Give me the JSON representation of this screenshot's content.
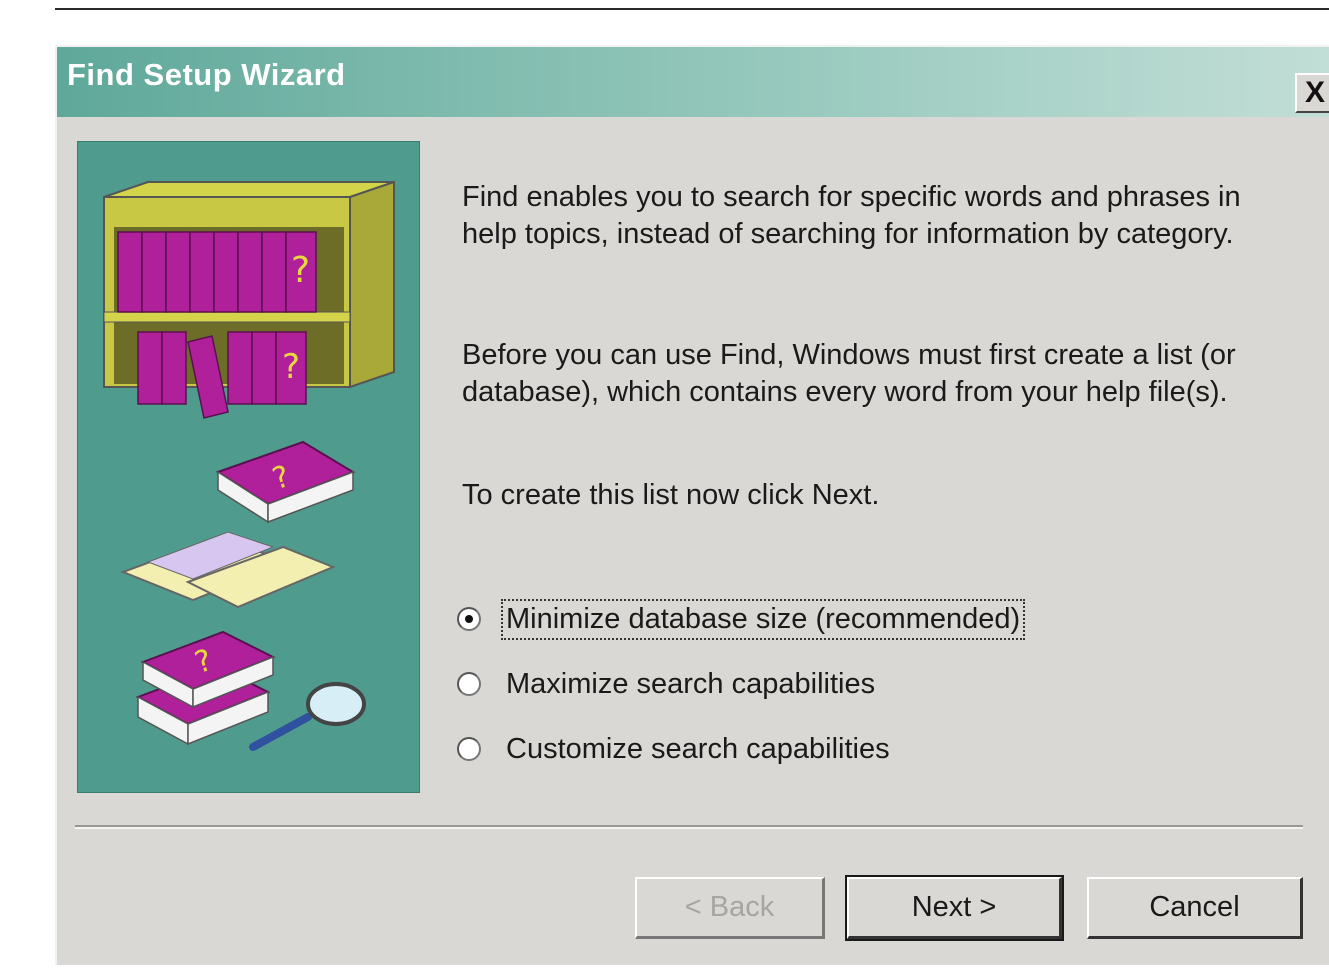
{
  "window": {
    "title": "Find Setup Wizard",
    "close_label": "X"
  },
  "main": {
    "paragraph1": "Find enables you to search for specific words and phrases in help topics, instead of searching for information by category.",
    "paragraph2": "Before you can use Find, Windows must first create a list (or database), which contains every word from your help file(s).",
    "paragraph3": "To create this list now click Next."
  },
  "options": [
    {
      "label": "Minimize database size (recommended)",
      "selected": true
    },
    {
      "label": "Maximize search capabilities",
      "selected": false
    },
    {
      "label": "Customize search capabilities",
      "selected": false
    }
  ],
  "buttons": {
    "back": "< Back",
    "next": "Next >",
    "cancel": "Cancel"
  },
  "colors": {
    "titlebar_start": "#5fa89a",
    "titlebar_end": "#c2ded6",
    "illustration_bg": "#4f9b8d",
    "book_color": "#b0209a",
    "dialog_bg": "#dad8d4"
  }
}
